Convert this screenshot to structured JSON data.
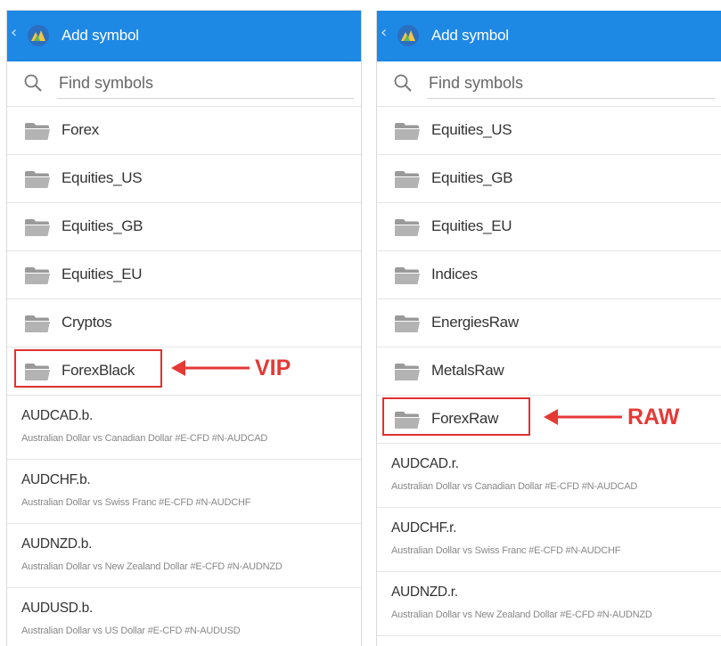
{
  "colors": {
    "appbar": "#1e88e5",
    "accent_red": "#e53935"
  },
  "left_panel": {
    "title": "Add symbol",
    "search": {
      "placeholder": "Find symbols"
    },
    "folders": [
      "Forex",
      "Equities_US",
      "Equities_GB",
      "Equities_EU",
      "Cryptos",
      "ForexBlack"
    ],
    "symbols": [
      {
        "name": "AUDCAD.b.",
        "desc": "Australian Dollar vs Canadian Dollar #E-CFD #N-AUDCAD"
      },
      {
        "name": "AUDCHF.b.",
        "desc": "Australian Dollar vs Swiss Franc #E-CFD #N-AUDCHF"
      },
      {
        "name": "AUDNZD.b.",
        "desc": "Australian Dollar vs New Zealand Dollar #E-CFD #N-AUDNZD"
      },
      {
        "name": "AUDUSD.b.",
        "desc": "Australian Dollar vs US Dollar #E-CFD #N-AUDUSD"
      }
    ],
    "callout": "VIP"
  },
  "right_panel": {
    "title": "Add symbol",
    "search": {
      "placeholder": "Find symbols"
    },
    "folders": [
      "Equities_US",
      "Equities_GB",
      "Equities_EU",
      "Indices",
      "EnergiesRaw",
      "MetalsRaw",
      "ForexRaw"
    ],
    "symbols": [
      {
        "name": "AUDCAD.r.",
        "desc": "Australian Dollar vs Canadian Dollar #E-CFD #N-AUDCAD"
      },
      {
        "name": "AUDCHF.r.",
        "desc": "Australian Dollar vs Swiss Franc #E-CFD #N-AUDCHF"
      },
      {
        "name": "AUDNZD.r.",
        "desc": "Australian Dollar vs New Zealand Dollar #E-CFD #N-AUDNZD"
      }
    ],
    "callout": "RAW"
  }
}
